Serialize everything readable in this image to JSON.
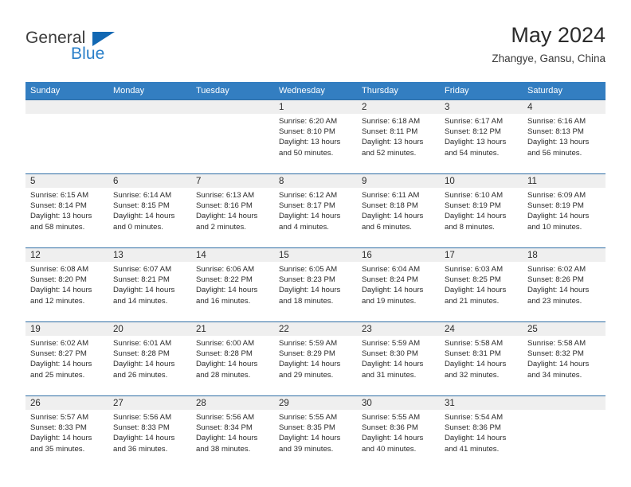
{
  "brand": {
    "name_part1": "General",
    "name_part2": "Blue",
    "triangle_icon": "triangle-icon",
    "accent_color": "#2a7fc9"
  },
  "header": {
    "month_title": "May 2024",
    "location": "Zhangye, Gansu, China"
  },
  "calendar": {
    "header_bg": "#337ec1",
    "row_border": "#2e6da4",
    "daynum_bg": "#efefef",
    "weekday_headers": [
      "Sunday",
      "Monday",
      "Tuesday",
      "Wednesday",
      "Thursday",
      "Friday",
      "Saturday"
    ],
    "weeks": [
      [
        {
          "day": "",
          "lines": []
        },
        {
          "day": "",
          "lines": []
        },
        {
          "day": "",
          "lines": []
        },
        {
          "day": "1",
          "lines": [
            "Sunrise: 6:20 AM",
            "Sunset: 8:10 PM",
            "Daylight: 13 hours",
            "and 50 minutes."
          ]
        },
        {
          "day": "2",
          "lines": [
            "Sunrise: 6:18 AM",
            "Sunset: 8:11 PM",
            "Daylight: 13 hours",
            "and 52 minutes."
          ]
        },
        {
          "day": "3",
          "lines": [
            "Sunrise: 6:17 AM",
            "Sunset: 8:12 PM",
            "Daylight: 13 hours",
            "and 54 minutes."
          ]
        },
        {
          "day": "4",
          "lines": [
            "Sunrise: 6:16 AM",
            "Sunset: 8:13 PM",
            "Daylight: 13 hours",
            "and 56 minutes."
          ]
        }
      ],
      [
        {
          "day": "5",
          "lines": [
            "Sunrise: 6:15 AM",
            "Sunset: 8:14 PM",
            "Daylight: 13 hours",
            "and 58 minutes."
          ]
        },
        {
          "day": "6",
          "lines": [
            "Sunrise: 6:14 AM",
            "Sunset: 8:15 PM",
            "Daylight: 14 hours",
            "and 0 minutes."
          ]
        },
        {
          "day": "7",
          "lines": [
            "Sunrise: 6:13 AM",
            "Sunset: 8:16 PM",
            "Daylight: 14 hours",
            "and 2 minutes."
          ]
        },
        {
          "day": "8",
          "lines": [
            "Sunrise: 6:12 AM",
            "Sunset: 8:17 PM",
            "Daylight: 14 hours",
            "and 4 minutes."
          ]
        },
        {
          "day": "9",
          "lines": [
            "Sunrise: 6:11 AM",
            "Sunset: 8:18 PM",
            "Daylight: 14 hours",
            "and 6 minutes."
          ]
        },
        {
          "day": "10",
          "lines": [
            "Sunrise: 6:10 AM",
            "Sunset: 8:19 PM",
            "Daylight: 14 hours",
            "and 8 minutes."
          ]
        },
        {
          "day": "11",
          "lines": [
            "Sunrise: 6:09 AM",
            "Sunset: 8:19 PM",
            "Daylight: 14 hours",
            "and 10 minutes."
          ]
        }
      ],
      [
        {
          "day": "12",
          "lines": [
            "Sunrise: 6:08 AM",
            "Sunset: 8:20 PM",
            "Daylight: 14 hours",
            "and 12 minutes."
          ]
        },
        {
          "day": "13",
          "lines": [
            "Sunrise: 6:07 AM",
            "Sunset: 8:21 PM",
            "Daylight: 14 hours",
            "and 14 minutes."
          ]
        },
        {
          "day": "14",
          "lines": [
            "Sunrise: 6:06 AM",
            "Sunset: 8:22 PM",
            "Daylight: 14 hours",
            "and 16 minutes."
          ]
        },
        {
          "day": "15",
          "lines": [
            "Sunrise: 6:05 AM",
            "Sunset: 8:23 PM",
            "Daylight: 14 hours",
            "and 18 minutes."
          ]
        },
        {
          "day": "16",
          "lines": [
            "Sunrise: 6:04 AM",
            "Sunset: 8:24 PM",
            "Daylight: 14 hours",
            "and 19 minutes."
          ]
        },
        {
          "day": "17",
          "lines": [
            "Sunrise: 6:03 AM",
            "Sunset: 8:25 PM",
            "Daylight: 14 hours",
            "and 21 minutes."
          ]
        },
        {
          "day": "18",
          "lines": [
            "Sunrise: 6:02 AM",
            "Sunset: 8:26 PM",
            "Daylight: 14 hours",
            "and 23 minutes."
          ]
        }
      ],
      [
        {
          "day": "19",
          "lines": [
            "Sunrise: 6:02 AM",
            "Sunset: 8:27 PM",
            "Daylight: 14 hours",
            "and 25 minutes."
          ]
        },
        {
          "day": "20",
          "lines": [
            "Sunrise: 6:01 AM",
            "Sunset: 8:28 PM",
            "Daylight: 14 hours",
            "and 26 minutes."
          ]
        },
        {
          "day": "21",
          "lines": [
            "Sunrise: 6:00 AM",
            "Sunset: 8:28 PM",
            "Daylight: 14 hours",
            "and 28 minutes."
          ]
        },
        {
          "day": "22",
          "lines": [
            "Sunrise: 5:59 AM",
            "Sunset: 8:29 PM",
            "Daylight: 14 hours",
            "and 29 minutes."
          ]
        },
        {
          "day": "23",
          "lines": [
            "Sunrise: 5:59 AM",
            "Sunset: 8:30 PM",
            "Daylight: 14 hours",
            "and 31 minutes."
          ]
        },
        {
          "day": "24",
          "lines": [
            "Sunrise: 5:58 AM",
            "Sunset: 8:31 PM",
            "Daylight: 14 hours",
            "and 32 minutes."
          ]
        },
        {
          "day": "25",
          "lines": [
            "Sunrise: 5:58 AM",
            "Sunset: 8:32 PM",
            "Daylight: 14 hours",
            "and 34 minutes."
          ]
        }
      ],
      [
        {
          "day": "26",
          "lines": [
            "Sunrise: 5:57 AM",
            "Sunset: 8:33 PM",
            "Daylight: 14 hours",
            "and 35 minutes."
          ]
        },
        {
          "day": "27",
          "lines": [
            "Sunrise: 5:56 AM",
            "Sunset: 8:33 PM",
            "Daylight: 14 hours",
            "and 36 minutes."
          ]
        },
        {
          "day": "28",
          "lines": [
            "Sunrise: 5:56 AM",
            "Sunset: 8:34 PM",
            "Daylight: 14 hours",
            "and 38 minutes."
          ]
        },
        {
          "day": "29",
          "lines": [
            "Sunrise: 5:55 AM",
            "Sunset: 8:35 PM",
            "Daylight: 14 hours",
            "and 39 minutes."
          ]
        },
        {
          "day": "30",
          "lines": [
            "Sunrise: 5:55 AM",
            "Sunset: 8:36 PM",
            "Daylight: 14 hours",
            "and 40 minutes."
          ]
        },
        {
          "day": "31",
          "lines": [
            "Sunrise: 5:54 AM",
            "Sunset: 8:36 PM",
            "Daylight: 14 hours",
            "and 41 minutes."
          ]
        },
        {
          "day": "",
          "lines": []
        }
      ]
    ]
  }
}
